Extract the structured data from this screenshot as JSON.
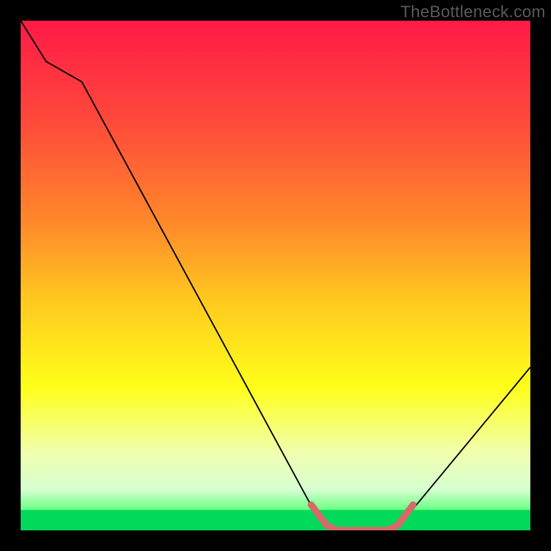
{
  "watermark": "TheBottleneck.com",
  "chart_data": {
    "type": "line",
    "title": "",
    "xlabel": "",
    "ylabel": "",
    "xlim": [
      0,
      100
    ],
    "ylim": [
      0,
      100
    ],
    "highlight_band_y": [
      0,
      4
    ],
    "series": [
      {
        "name": "bottleneck-curve",
        "x": [
          0,
          5,
          12,
          58,
          62,
          72,
          76,
          100
        ],
        "y": [
          100,
          92,
          88,
          3,
          0,
          0,
          3,
          32
        ]
      },
      {
        "name": "optimal-range",
        "x": [
          57,
          60,
          62,
          72,
          74,
          77
        ],
        "y": [
          5,
          1,
          0,
          0,
          1,
          5
        ]
      }
    ],
    "gradient_stops": [
      {
        "offset": 0,
        "color": "#ff1a47"
      },
      {
        "offset": 20,
        "color": "#ff4a3a"
      },
      {
        "offset": 40,
        "color": "#ff8a2a"
      },
      {
        "offset": 55,
        "color": "#ffc91f"
      },
      {
        "offset": 72,
        "color": "#ffff1a"
      },
      {
        "offset": 85,
        "color": "#f0ffb0"
      },
      {
        "offset": 92,
        "color": "#d6ffd0"
      },
      {
        "offset": 97,
        "color": "#50ff70"
      },
      {
        "offset": 100,
        "color": "#00e060"
      }
    ]
  }
}
